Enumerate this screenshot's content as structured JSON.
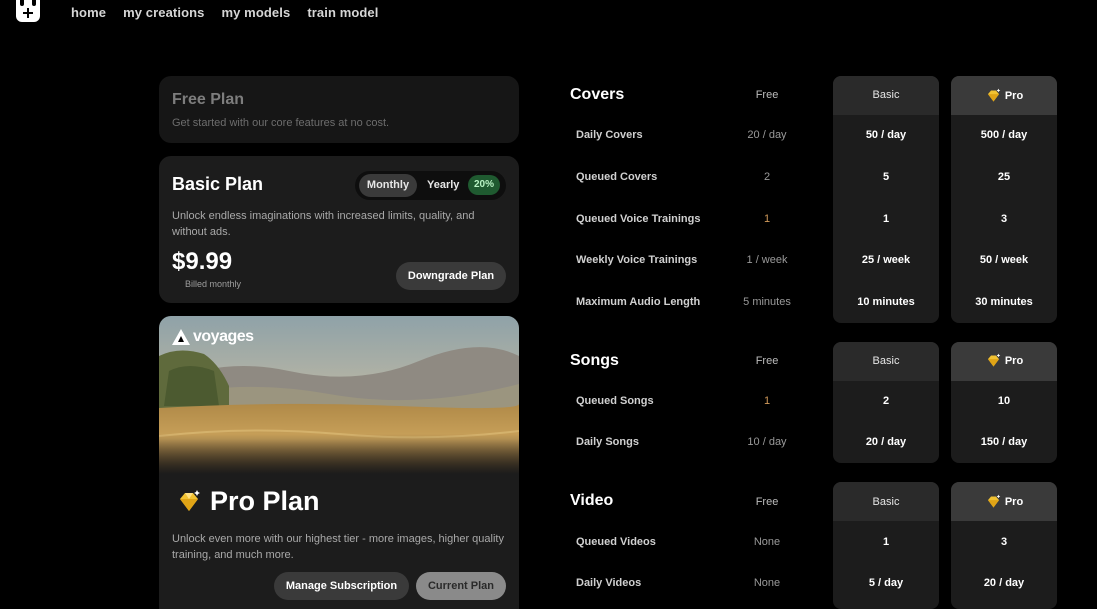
{
  "nav": {
    "items": [
      "home",
      "my creations",
      "my models",
      "train model"
    ]
  },
  "free_plan": {
    "title": "Free Plan",
    "description": "Get started with our core features at no cost."
  },
  "basic_plan": {
    "title": "Basic Plan",
    "toggle_monthly": "Monthly",
    "toggle_yearly": "Yearly",
    "yearly_discount": "20%",
    "description": "Unlock endless imaginations with increased limits, quality, and without ads.",
    "price": "$9.99",
    "billed": "Billed monthly",
    "button": "Downgrade Plan"
  },
  "pro_plan": {
    "brand": "voyages",
    "title": "Pro Plan",
    "description": "Unlock even more with our highest tier - more images, higher quality training, and much more.",
    "manage_button": "Manage Subscription",
    "current_button": "Current Plan"
  },
  "tables": {
    "col_free": "Free",
    "col_basic": "Basic",
    "col_pro": "Pro",
    "covers": {
      "title": "Covers",
      "rows": [
        {
          "label": "Daily Covers",
          "free": "20 / day",
          "basic": "50 / day",
          "pro": "500 / day"
        },
        {
          "label": "Queued Covers",
          "free": "2",
          "basic": "5",
          "pro": "25"
        },
        {
          "label": "Queued Voice Trainings",
          "free": "1",
          "basic": "1",
          "pro": "3"
        },
        {
          "label": "Weekly Voice Trainings",
          "free": "1 / week",
          "basic": "25 / week",
          "pro": "50 / week"
        },
        {
          "label": "Maximum Audio Length",
          "free": "5 minutes",
          "basic": "10 minutes",
          "pro": "30 minutes"
        }
      ]
    },
    "songs": {
      "title": "Songs",
      "rows": [
        {
          "label": "Queued Songs",
          "free": "1",
          "basic": "2",
          "pro": "10"
        },
        {
          "label": "Daily Songs",
          "free": "10 / day",
          "basic": "20 / day",
          "pro": "150 / day"
        }
      ]
    },
    "video": {
      "title": "Video",
      "rows": [
        {
          "label": "Queued Videos",
          "free": "None",
          "basic": "1",
          "pro": "3"
        },
        {
          "label": "Daily Videos",
          "free": "None",
          "basic": "5 / day",
          "pro": "20 / day"
        }
      ]
    }
  },
  "colors": {
    "accent_green": "#1f5a30",
    "highlight_orange": "#d19a5a"
  }
}
